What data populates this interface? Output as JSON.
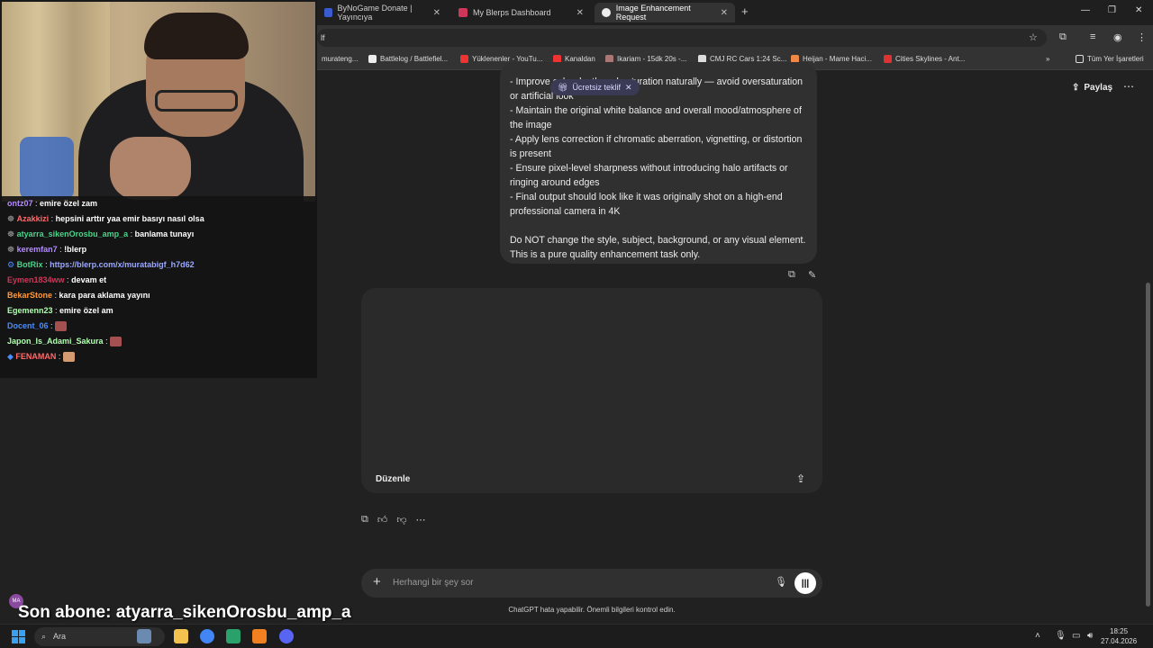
{
  "browser": {
    "tabs": [
      {
        "title": "ByNoGame Donate | Yayıncıya",
        "color": "#3a5ad0"
      },
      {
        "title": "My Blerps Dashboard",
        "color": "#d0365a"
      },
      {
        "title": "Image Enhancement Request",
        "color": "#ececec"
      }
    ],
    "address": "lf",
    "bookmarks": [
      {
        "label": "murateng...",
        "color": "#888"
      },
      {
        "label": "Battlelog / Battlefiel...",
        "color": "#eee"
      },
      {
        "label": "Yüklenenler - YouTu...",
        "color": "#e33"
      },
      {
        "label": "Kanaldan",
        "color": "#e33"
      },
      {
        "label": "Ikariam - 15dk 20s -...",
        "color": "#a77"
      },
      {
        "label": "CMJ RC Cars 1:24 Sc...",
        "color": "#ddd"
      },
      {
        "label": "Heijan - Mame Haci...",
        "color": "#e84"
      },
      {
        "label": "Cities Skylines - Ant...",
        "color": "#d33"
      },
      {
        "label": "Tüm Yer İşaretleri",
        "color": "#ddd"
      }
    ]
  },
  "chat_page": {
    "share_label": "Paylaş",
    "badge_label": "Ücretsiz teklif",
    "prompt_lines": [
      "- Improve color depth and saturation naturally — avoid oversaturation or artificial look",
      "- Maintain the original white balance and overall mood/atmosphere of the image",
      "- Apply lens correction if chromatic aberration, vignetting, or distortion is present",
      "- Ensure pixel-level sharpness without introducing halo artifacts or ringing around edges",
      "- Final output should look like it was originally shot on a high-end professional camera in 4K",
      "",
      "Do NOT change the style, subject, background, or any visual element. This is a pure quality enhancement task only."
    ],
    "edit_label": "Düzenle",
    "composer_placeholder": "Herhangi bir şey sor",
    "disclaimer": "ChatGPT hata yapabilir. Önemli bilgileri kontrol edin."
  },
  "stream_chat": [
    {
      "user": "ontz07",
      "msg": "emire özel zam",
      "color": "#b48cff"
    },
    {
      "user": "Azakkizi",
      "msg": "hepsini arttır yaa emir basıyı nasıl olsa",
      "color": "#ff6a6a"
    },
    {
      "user": "atyarra_sikenOrosbu_amp_a",
      "msg": "banlama tunayı",
      "color": "#4ad48a"
    },
    {
      "user": "keremfan7",
      "msg": "!blerp",
      "color": "#b48cff"
    },
    {
      "user": "BotRix",
      "msg": "https://blerp.com/x/muratabigf_h7d62",
      "color": "#4ad48a",
      "link": true
    },
    {
      "user": "Eymen1834ww",
      "msg": "devam et",
      "color": "#d0365a"
    },
    {
      "user": "BekarStone",
      "msg": "kara para aklama yayını",
      "color": "#ff9a3c"
    },
    {
      "user": "Egemenn23",
      "msg": "emire özel am",
      "color": "#b0ffb0"
    },
    {
      "user": "Docent_06",
      "msg": "",
      "color": "#4a8cff",
      "emote": true
    },
    {
      "user": "Japon_Is_Adami_Sakura",
      "msg": "",
      "color": "#b0ffb0",
      "emote": true
    },
    {
      "user": "FENAMAN",
      "msg": "",
      "color": "#ff6a6a",
      "emote": true
    }
  ],
  "overlay": {
    "sub_banner": "Son abone: atyarra_sikenOrosbu_amp_a",
    "avatar_initials": "MA"
  },
  "taskbar": {
    "search_label": "Ara",
    "time": "18:25",
    "date": "27.04.2026"
  }
}
